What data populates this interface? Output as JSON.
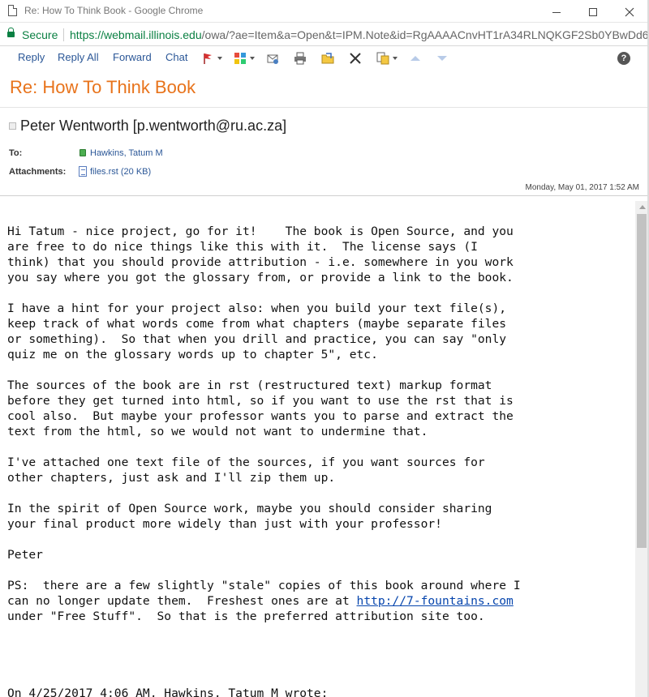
{
  "window": {
    "title": "Re: How To Think Book - Google Chrome"
  },
  "address_bar": {
    "secure_label": "Secure",
    "url_host": "https://webmail.illinois.edu",
    "url_rest": "/owa/?ae=Item&a=Open&t=IPM.Note&id=RgAAAACnvHT1rA34RLNQKGF2Sb0YBwDd6"
  },
  "toolbar": {
    "reply": "Reply",
    "reply_all": "Reply All",
    "forward": "Forward",
    "chat": "Chat",
    "help": "?",
    "icons": [
      "flag-icon",
      "categories-icon",
      "move-icon",
      "print-icon",
      "folder-icon",
      "delete-icon",
      "copy-icon",
      "previous-icon",
      "next-icon",
      "help-icon"
    ]
  },
  "message": {
    "subject": "Re: How To Think Book",
    "sender": "Peter Wentworth [p.wentworth@ru.ac.za]",
    "to_label": "To:",
    "to_value": "Hawkins, Tatum M",
    "attachments_label": "Attachments:",
    "attachment": "files.rst (20 KB)",
    "date": "Monday, May 01, 2017 1:52 AM",
    "body_before_link": "Hi Tatum - nice project, go for it!    The book is Open Source, and you\nare free to do nice things like this with it.  The license says (I\nthink) that you should provide attribution - i.e. somewhere in you work\nyou say where you got the glossary from, or provide a link to the book.\n\nI have a hint for your project also: when you build your text file(s),\nkeep track of what words come from what chapters (maybe separate files\nor something).  So that when you drill and practice, you can say \"only\nquiz me on the glossary words up to chapter 5\", etc.\n\nThe sources of the book are in rst (restructured text) markup format\nbefore they get turned into html, so if you want to use the rst that is\ncool also.  But maybe your professor wants you to parse and extract the\ntext from the html, so we would not want to undermine that.\n\nI've attached one text file of the sources, if you want sources for\nother chapters, just ask and I'll zip them up.\n\nIn the spirit of Open Source work, maybe you should consider sharing\nyour final product more widely than just with your professor!\n\nPeter\n\nPS:  there are a few slightly \"stale\" copies of this book around where I\ncan no longer update them.  Freshest ones are at ",
    "link": "http://7-fountains.com",
    "body_after_link": "\nunder \"Free Stuff\".  So that is the preferred attribution site too.\n\n\n\n\nOn 4/25/2017 4:06 AM, Hawkins, Tatum M wrote:\n> Hi Mr. Wentworth,"
  },
  "colors": {
    "subject": "#e8731b",
    "link": "#2b5797",
    "secure": "#0b8043"
  }
}
